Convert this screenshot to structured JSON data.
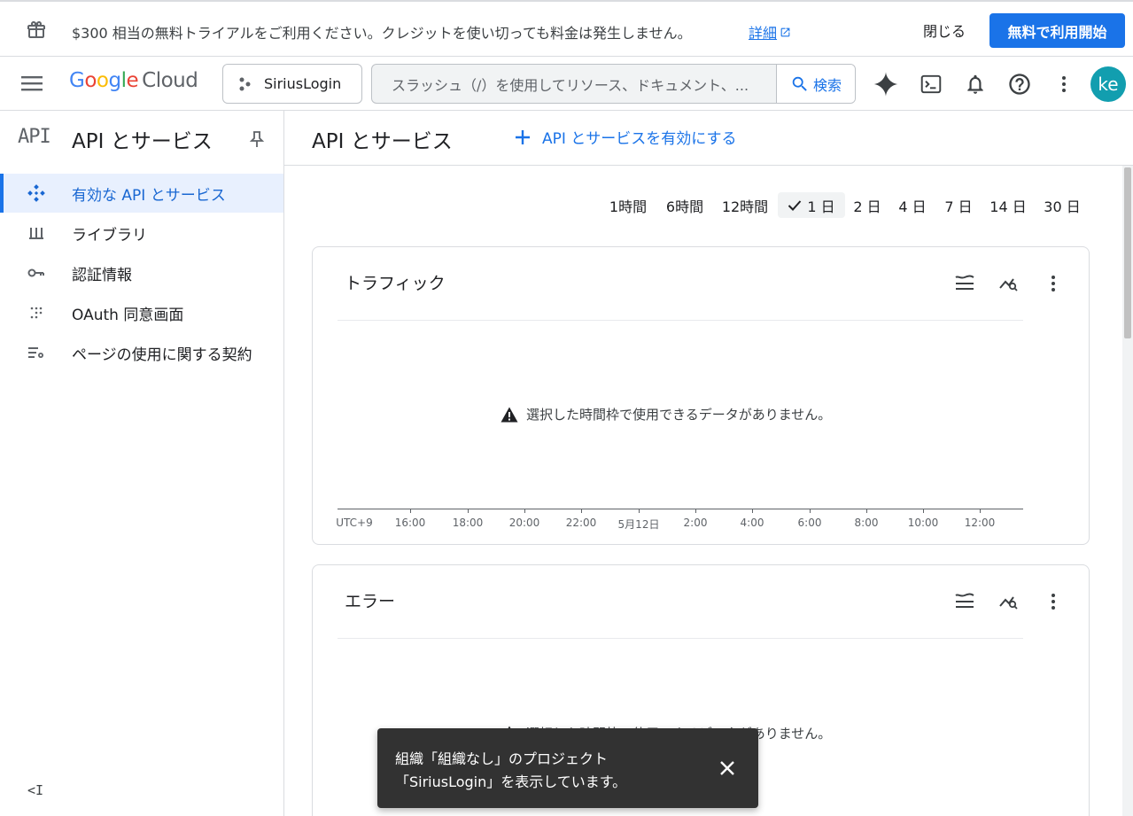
{
  "banner": {
    "message": "$300 相当の無料トライアルをご利用ください。クレジットを使い切っても料金は発生しません。",
    "details_link": "詳細",
    "close_label": "閉じる",
    "trial_button": "無料で利用開始"
  },
  "header": {
    "logo_google": "Google",
    "logo_cloud": "Cloud",
    "project": "SiriusLogin",
    "search_placeholder": "スラッシュ（/）を使用してリソース、ドキュメント、...",
    "search_button": "検索",
    "avatar_initials": "ke"
  },
  "sidebar": {
    "badge": "API",
    "title": "API とサービス",
    "items": [
      {
        "label": "有効な API とサービス",
        "icon": "api-diamond-icon",
        "active": true
      },
      {
        "label": "ライブラリ",
        "icon": "library-icon",
        "active": false
      },
      {
        "label": "認証情報",
        "icon": "key-icon",
        "active": false
      },
      {
        "label": "OAuth 同意画面",
        "icon": "oauth-dots-icon",
        "active": false
      },
      {
        "label": "ページの使用に関する契約",
        "icon": "settings-list-icon",
        "active": false
      }
    ],
    "collapse_label": "<I"
  },
  "main": {
    "title": "API とサービス",
    "enable_button": "API とサービスを有効にする",
    "time_ranges": [
      {
        "label": "1時間",
        "selected": false
      },
      {
        "label": "6時間",
        "selected": false
      },
      {
        "label": "12時間",
        "selected": false
      },
      {
        "label": "1 日",
        "selected": true
      },
      {
        "label": "2 日",
        "selected": false
      },
      {
        "label": "4 日",
        "selected": false
      },
      {
        "label": "7 日",
        "selected": false
      },
      {
        "label": "14 日",
        "selected": false
      },
      {
        "label": "30 日",
        "selected": false
      }
    ]
  },
  "cards": [
    {
      "title": "トラフィック",
      "no_data": "選択した時間枠で使用できるデータがありません。",
      "axis_ticks": [
        "UTC+9",
        "16:00",
        "18:00",
        "20:00",
        "22:00",
        "5月12日",
        "2:00",
        "4:00",
        "6:00",
        "8:00",
        "10:00",
        "12:00"
      ]
    },
    {
      "title": "エラー",
      "no_data": "選択した時間枠で使用できるデータがありません。"
    }
  ],
  "snackbar": {
    "line1": "組織「組織なし」のプロジェクト",
    "line2": "「SiriusLogin」を表示しています。"
  },
  "colors": {
    "accent": "#1a73e8",
    "avatar": "#129eaf",
    "snackbar": "#323232"
  }
}
